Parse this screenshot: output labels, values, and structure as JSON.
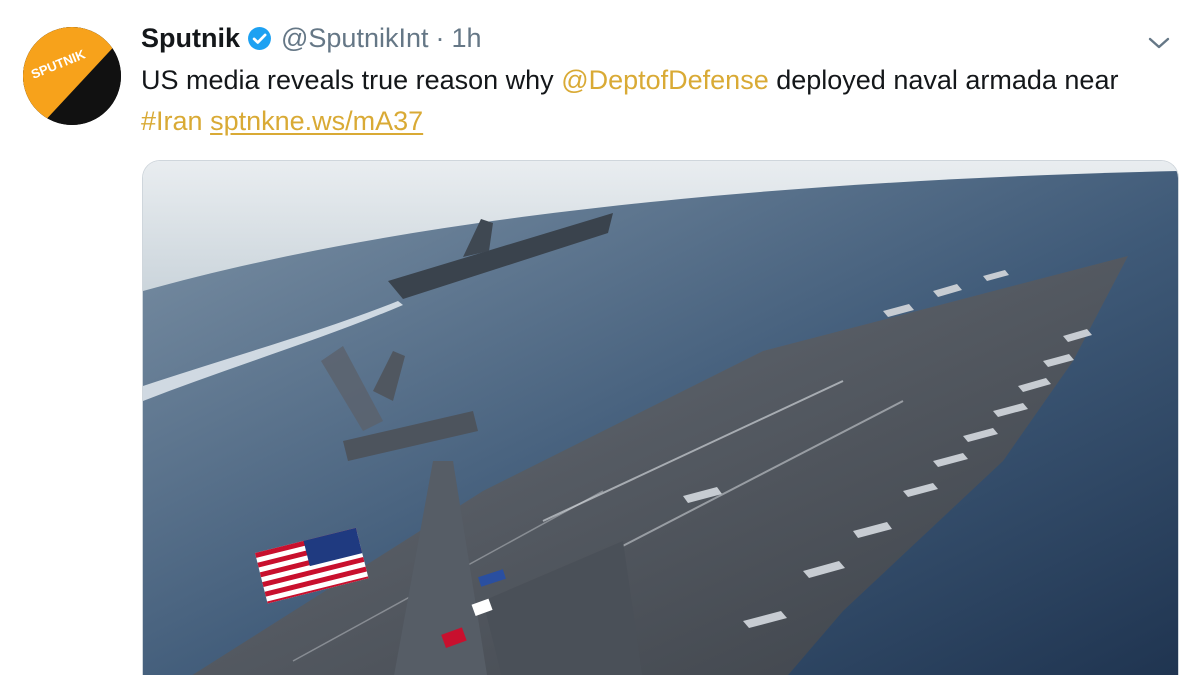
{
  "tweet": {
    "display_name": "Sputnik",
    "handle": "@SputnikInt",
    "separator": "·",
    "timestamp": "1h",
    "avatar_text": "SPUTNIK",
    "text": {
      "part1": "US media reveals true reason why ",
      "mention": "@DeptofDefense",
      "part2": " deployed naval armada near",
      "hashtag": "#Iran",
      "link": "sptnkne.ws/mA37"
    }
  },
  "colors": {
    "accent": "#d9aa35",
    "text": "#14171a",
    "secondary": "#657786",
    "verified": "#1da1f2",
    "avatar_orange": "#f7a21b"
  },
  "icons": {
    "verified": "verified-badge-icon",
    "menu": "chevron-down-icon"
  }
}
